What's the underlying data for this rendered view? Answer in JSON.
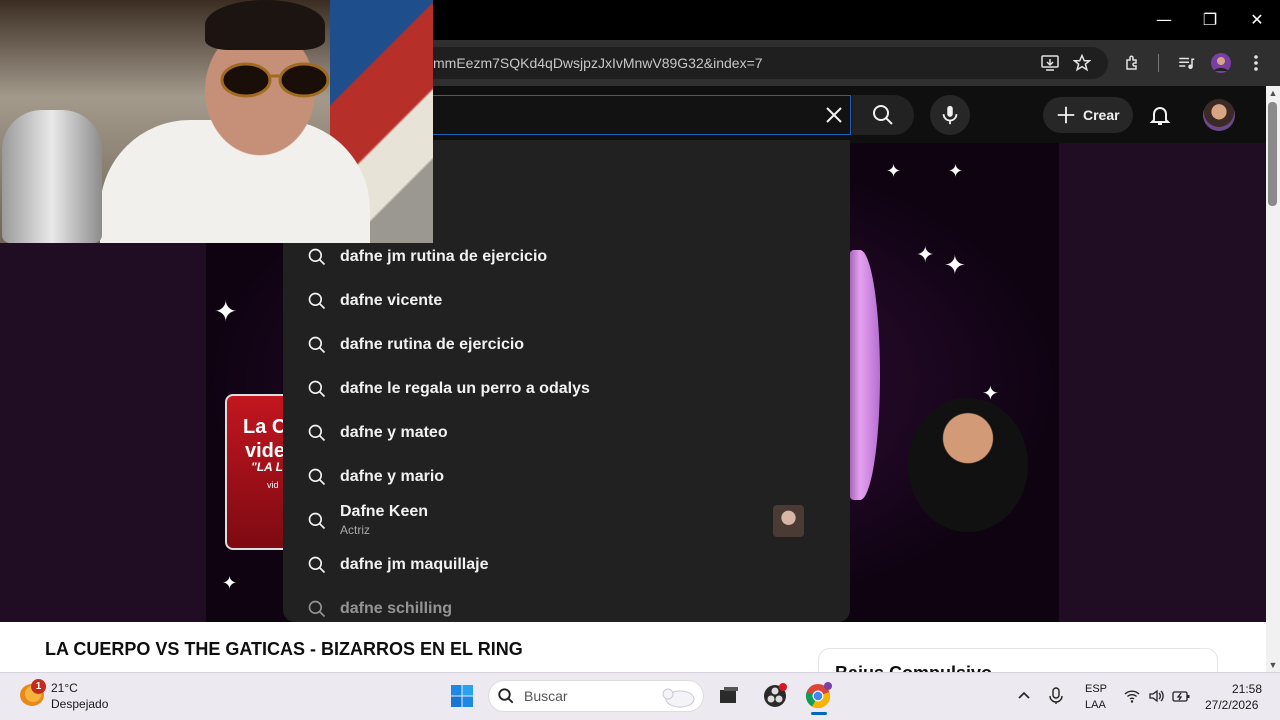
{
  "browser": {
    "url": "mmEezm7SQKd4qDwsjpzJxIvMnwV89G32&index=7",
    "window_controls": [
      "minimize",
      "restore",
      "close"
    ]
  },
  "header": {
    "create_label": "Crear"
  },
  "suggestions": [
    {
      "text": "dafne jm rutina de ejercicio"
    },
    {
      "text": "dafne vicente"
    },
    {
      "text": "dafne rutina de ejercicio"
    },
    {
      "text": "dafne le regala un perro a odalys"
    },
    {
      "text": "dafne y mateo"
    },
    {
      "text": "dafne y mario"
    },
    {
      "text": "Dafne Keen",
      "subtitle": "Actriz"
    },
    {
      "text": "dafne jm maquillaje"
    },
    {
      "text": "dafne schilling"
    }
  ],
  "video": {
    "card_line1": "La C",
    "card_line2": "vide",
    "card_line3": "\"LA L",
    "card_line4": "vid"
  },
  "page": {
    "video_title": "LA CUERPO VS THE GATICAS - BIZARROS EN EL RING",
    "side_card_title": "Bajus Compulsivo"
  },
  "taskbar": {
    "weather_temp": "21°C",
    "weather_desc": "Despejado",
    "weather_badge": "1",
    "search_placeholder": "Buscar",
    "lang_line1": "ESP",
    "lang_line2": "LAA",
    "time": "21:58",
    "date": "27/2/2026"
  },
  "colors": {
    "yt_bg": "#0f0f0f",
    "dropdown_bg": "#212121",
    "search_focus_border": "#1c62b9",
    "taskbar_bg": "#ece9f0",
    "accent_blue": "#0067c0"
  }
}
